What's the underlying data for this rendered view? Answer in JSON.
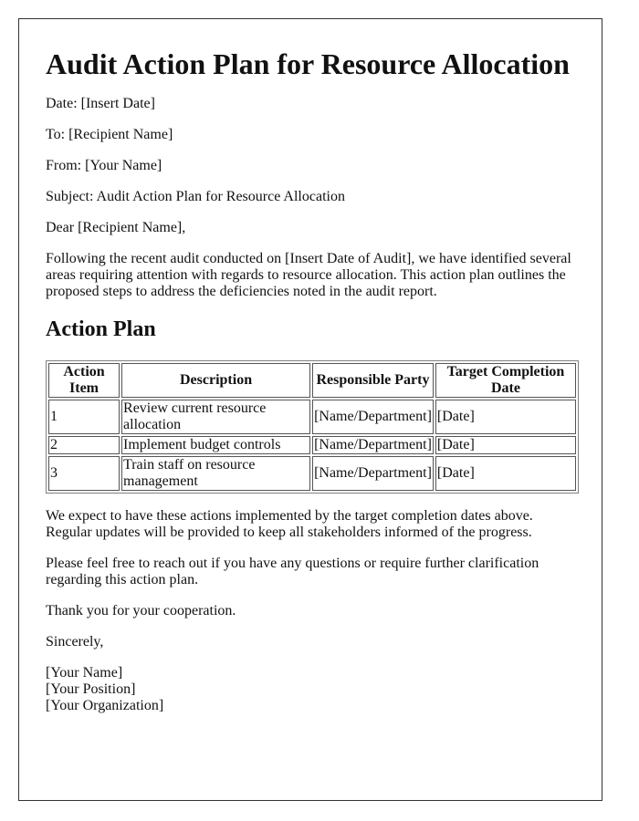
{
  "document": {
    "title": "Audit Action Plan for Resource Allocation",
    "date_line": "Date: [Insert Date]",
    "to_line": "To: [Recipient Name]",
    "from_line": "From: [Your Name]",
    "subject_line": "Subject: Audit Action Plan for Resource Allocation",
    "salutation": "Dear [Recipient Name],",
    "intro_paragraph": "Following the recent audit conducted on [Insert Date of Audit], we have identified several areas requiring attention with regards to resource allocation. This action plan outlines the proposed steps to address the deficiencies noted in the audit report.",
    "section_heading": "Action Plan",
    "table": {
      "headers": [
        "Action Item",
        "Description",
        "Responsible Party",
        "Target Completion Date"
      ],
      "rows": [
        {
          "item": "1",
          "description": "Review current resource allocation",
          "party": "[Name/Department]",
          "date": "[Date]"
        },
        {
          "item": "2",
          "description": "Implement budget controls",
          "party": "[Name/Department]",
          "date": "[Date]"
        },
        {
          "item": "3",
          "description": "Train staff on resource management",
          "party": "[Name/Department]",
          "date": "[Date]"
        }
      ]
    },
    "expectation_paragraph": "We expect to have these actions implemented by the target completion dates above. Regular updates will be provided to keep all stakeholders informed of the progress.",
    "contact_paragraph": "Please feel free to reach out if you have any questions or require further clarification regarding this action plan.",
    "thanks_line": "Thank you for your cooperation.",
    "closing": "Sincerely,",
    "signature": {
      "name": "[Your Name]",
      "position": "[Your Position]",
      "organization": "[Your Organization]"
    }
  }
}
